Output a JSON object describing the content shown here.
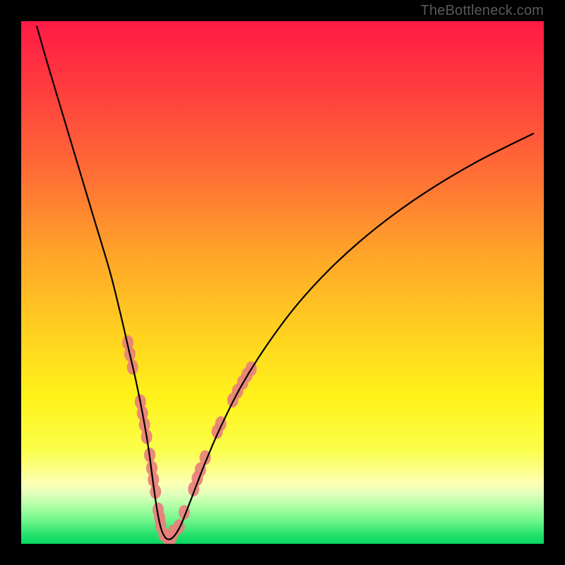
{
  "watermark": "TheBottleneck.com",
  "colors": {
    "frame": "#000000",
    "curve": "#000000",
    "markers": "#e8807b",
    "gradient_stops": [
      {
        "offset": 0.0,
        "color": "#ff1a45"
      },
      {
        "offset": 0.12,
        "color": "#ff3a3f"
      },
      {
        "offset": 0.28,
        "color": "#ff6a36"
      },
      {
        "offset": 0.45,
        "color": "#ffa629"
      },
      {
        "offset": 0.6,
        "color": "#ffd21f"
      },
      {
        "offset": 0.72,
        "color": "#fff21a"
      },
      {
        "offset": 0.82,
        "color": "#fbff4a"
      },
      {
        "offset": 0.885,
        "color": "#fcffb5"
      },
      {
        "offset": 0.905,
        "color": "#dfffba"
      },
      {
        "offset": 0.925,
        "color": "#b5ffa8"
      },
      {
        "offset": 0.955,
        "color": "#70f58a"
      },
      {
        "offset": 0.985,
        "color": "#1fe06a"
      },
      {
        "offset": 1.0,
        "color": "#08d860"
      }
    ]
  },
  "chart_data": {
    "type": "line",
    "title": "",
    "xlabel": "",
    "ylabel": "",
    "xlim": [
      0,
      100
    ],
    "ylim": [
      0,
      100
    ],
    "series": [
      {
        "name": "bottleneck-curve",
        "x": [
          3,
          5,
          8,
          11,
          14,
          17,
          19,
          20.5,
          22,
          23.3,
          24.4,
          25.2,
          26,
          26.8,
          27.8,
          29,
          30.5,
          32.5,
          35,
          38,
          42,
          47,
          53,
          60,
          68,
          77,
          87,
          98
        ],
        "y": [
          99,
          92,
          82,
          72,
          62,
          52,
          44,
          37.5,
          31,
          24.5,
          18,
          12,
          6.5,
          2.8,
          1.0,
          1.2,
          3.5,
          8.5,
          15,
          22,
          30,
          38,
          46,
          53.5,
          60.5,
          67,
          73,
          78.5
        ]
      }
    ],
    "markers": {
      "name": "sample-points",
      "points": [
        {
          "x": 20.4,
          "y": 38.5
        },
        {
          "x": 20.8,
          "y": 36.3
        },
        {
          "x": 21.3,
          "y": 33.8
        },
        {
          "x": 22.8,
          "y": 27.2
        },
        {
          "x": 23.2,
          "y": 25.0
        },
        {
          "x": 23.6,
          "y": 22.8
        },
        {
          "x": 24.0,
          "y": 20.5
        },
        {
          "x": 24.6,
          "y": 17.0
        },
        {
          "x": 25.0,
          "y": 14.5
        },
        {
          "x": 25.3,
          "y": 12.3
        },
        {
          "x": 25.7,
          "y": 10.0
        },
        {
          "x": 26.2,
          "y": 6.5
        },
        {
          "x": 26.5,
          "y": 5.0
        },
        {
          "x": 26.7,
          "y": 3.5
        },
        {
          "x": 27.3,
          "y": 1.8
        },
        {
          "x": 28.0,
          "y": 1.2
        },
        {
          "x": 28.7,
          "y": 1.2
        },
        {
          "x": 29.2,
          "y": 2.3
        },
        {
          "x": 30.2,
          "y": 3.3
        },
        {
          "x": 31.2,
          "y": 6.0
        },
        {
          "x": 33.0,
          "y": 10.5
        },
        {
          "x": 33.7,
          "y": 12.5
        },
        {
          "x": 34.3,
          "y": 14.2
        },
        {
          "x": 35.2,
          "y": 16.5
        },
        {
          "x": 37.5,
          "y": 21.5
        },
        {
          "x": 38.2,
          "y": 23.0
        },
        {
          "x": 40.5,
          "y": 27.5
        },
        {
          "x": 41.4,
          "y": 29.2
        },
        {
          "x": 42.4,
          "y": 30.9
        },
        {
          "x": 43.2,
          "y": 32.3
        },
        {
          "x": 44.0,
          "y": 33.5
        }
      ]
    }
  }
}
